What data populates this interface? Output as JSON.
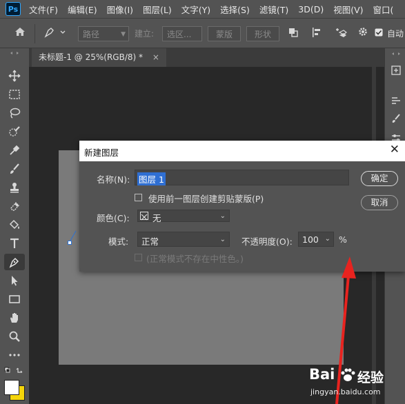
{
  "menubar": {
    "logo": "Ps",
    "items": [
      "文件(F)",
      "编辑(E)",
      "图像(I)",
      "图层(L)",
      "文字(Y)",
      "选择(S)",
      "滤镜(T)",
      "3D(D)",
      "视图(V)",
      "窗口("
    ]
  },
  "options_bar": {
    "path_mode": "路径",
    "make_label": "建立:",
    "selection_btn": "选区...",
    "mask_btn": "蒙版",
    "shape_btn": "形状",
    "auto_label": "自动"
  },
  "document_tab": {
    "title": "未标题-1 @ 25%(RGB/8) *",
    "close": "×"
  },
  "dialog": {
    "title": "新建图层",
    "close": "✕",
    "name_label": "名称(N):",
    "name_value": "图层 1",
    "clip_checkbox_label": "使用前一图层创建剪贴蒙版(P)",
    "color_label": "颜色(C):",
    "color_value": "无",
    "mode_label": "模式:",
    "mode_value": "正常",
    "opacity_label": "不透明度(O):",
    "opacity_value": "100",
    "opacity_unit": "%",
    "neutral_label": "(正常模式不存在中性色。)",
    "ok_button": "确定",
    "cancel_button": "取消"
  },
  "watermark": {
    "brand": "Bai",
    "brand2": "经验",
    "url": "jingyan.baidu.com"
  },
  "colors": {
    "menubar_bg": "#535353",
    "canvas_bg": "#282828",
    "doc_canvas": "#7a7a7a",
    "annotation": "#e8231f",
    "foreground_swatch": "#ffffff",
    "background_swatch": "#f5d50a"
  }
}
